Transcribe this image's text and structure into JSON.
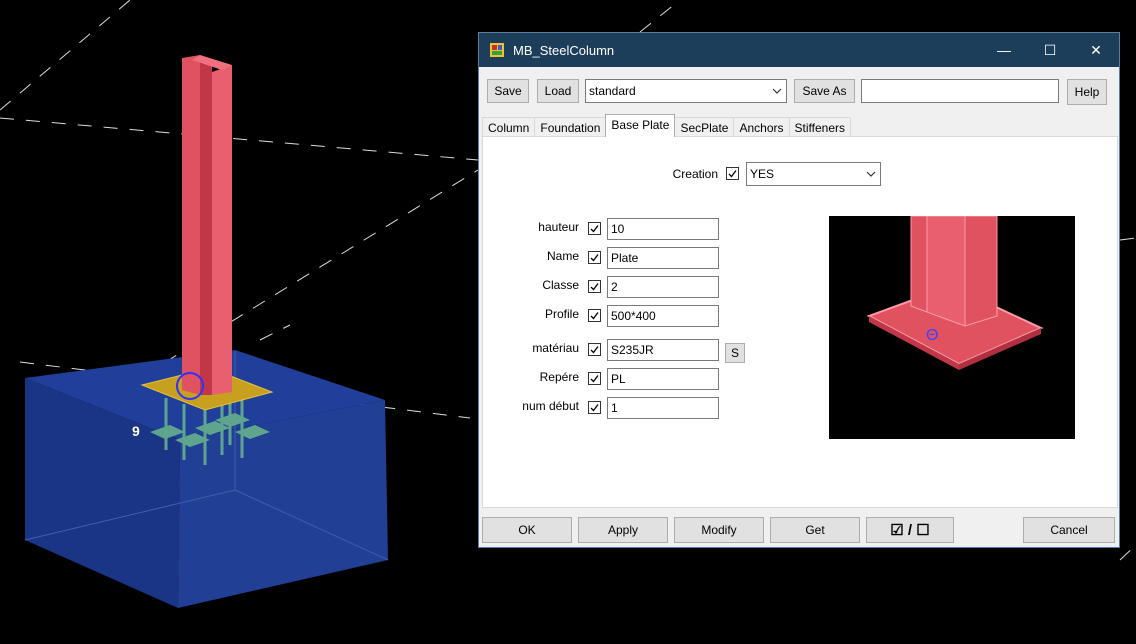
{
  "dialog": {
    "title": "MB_SteelColumn",
    "window_buttons": {
      "minimize": "—",
      "maximize": "☐",
      "close": "✕"
    }
  },
  "toolbar": {
    "save_label": "Save",
    "load_label": "Load",
    "preset_value": "standard",
    "save_as_label": "Save As",
    "save_as_name": "",
    "help_label": "Help"
  },
  "tabs": [
    {
      "label": "Column"
    },
    {
      "label": "Foundation"
    },
    {
      "label": "Base Plate"
    },
    {
      "label": "SecPlate"
    },
    {
      "label": "Anchors"
    },
    {
      "label": "Stiffeners"
    }
  ],
  "active_tab": "Base Plate",
  "creation": {
    "label": "Creation",
    "checked": true,
    "value": "YES"
  },
  "fields": [
    {
      "label": "hauteur",
      "checked": true,
      "value": "10"
    },
    {
      "label": "Name",
      "checked": true,
      "value": "Plate"
    },
    {
      "label": "Classe",
      "checked": true,
      "value": "2"
    },
    {
      "label": "Profile",
      "checked": true,
      "value": "500*400"
    },
    {
      "label": "matériau",
      "checked": true,
      "value": "S235JR"
    },
    {
      "label": "Repére",
      "checked": true,
      "value": "PL"
    },
    {
      "label": "num début",
      "checked": true,
      "value": "1"
    }
  ],
  "material_select_label": "S",
  "footer": {
    "ok_label": "OK",
    "apply_label": "Apply",
    "modify_label": "Modify",
    "get_label": "Get",
    "toggle_label": "☑ / ☐",
    "cancel_label": "Cancel"
  },
  "viewport": {
    "annotation": "9",
    "colors": {
      "column": "#e05260",
      "foundation": "#1f3f8f",
      "plate": "#c8a020"
    }
  },
  "colors": {
    "titlebar": "#1d3e5a",
    "dialog_bg": "#f0f0f0"
  }
}
